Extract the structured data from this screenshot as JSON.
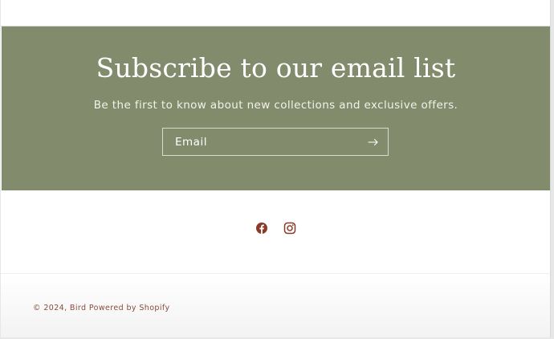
{
  "newsletter": {
    "title": "Subscribe to our email list",
    "subtitle": "Be the first to know about new collections and exclusive offers.",
    "email_placeholder": "Email",
    "background_color": "#828b6c"
  },
  "social": {
    "items": [
      {
        "name": "facebook",
        "icon": "facebook-icon"
      },
      {
        "name": "instagram",
        "icon": "instagram-icon"
      }
    ],
    "icon_color": "#8a3a26"
  },
  "footer": {
    "copyright": "© 2024, Bird Powered by Shopify"
  }
}
